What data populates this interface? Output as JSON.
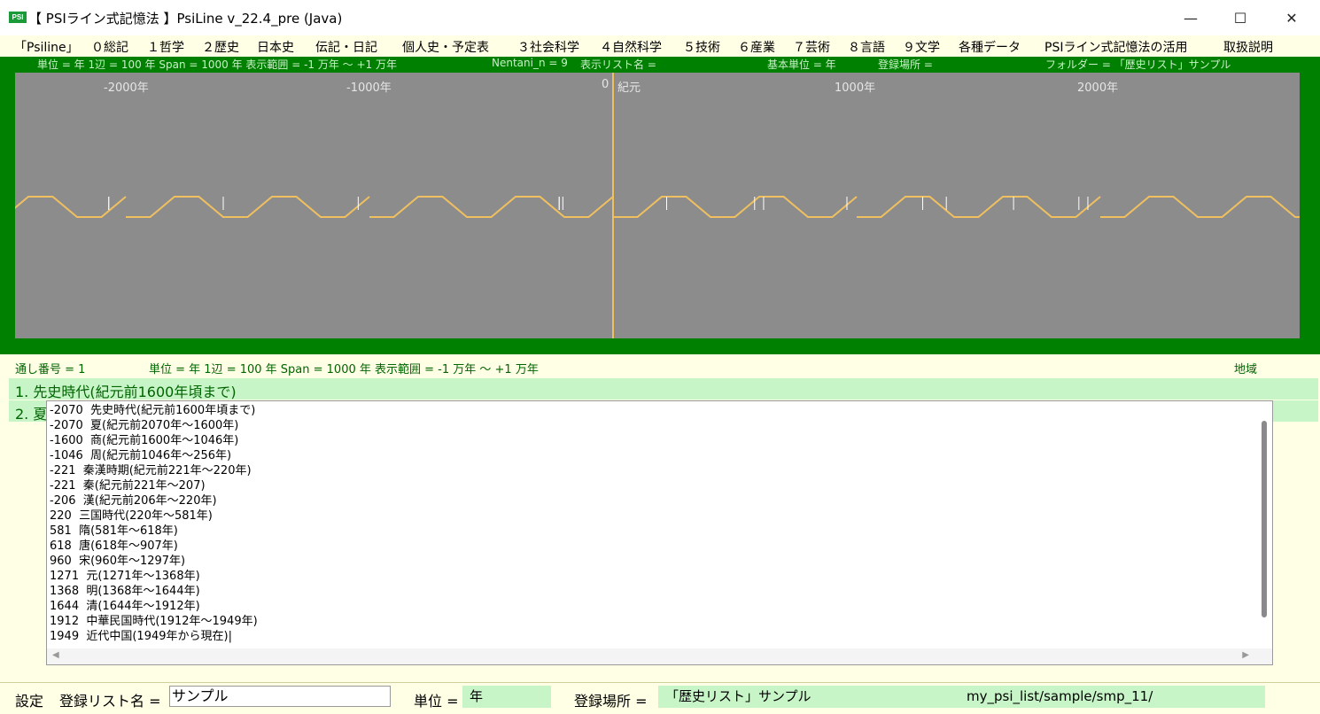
{
  "window": {
    "app_icon_text": "PSI",
    "title": "【 PSIライン式記憶法 】PsiLine v_22.4_pre (Java)",
    "minimize": "—",
    "maximize": "☐",
    "close": "✕"
  },
  "menu": [
    "「Psiline」",
    "０総記",
    "１哲学",
    "２歴史",
    "日本史",
    "伝記・日記",
    "個人史・予定表",
    "３社会科学",
    "４自然科学",
    "５技術",
    "６産業",
    "７芸術",
    "８言語",
    "９文学",
    "各種データ",
    "PSIライン式記憶法の活用",
    "取扱説明"
  ],
  "info_top": {
    "unit": "単位 = 年  1辺 = 100 年  Span = 1000 年  表示範囲 = -1 万年 〜 +1 万年",
    "nentani": "Nentani_n = 9",
    "list_name": "表示リスト名 =",
    "base_unit": "基本単位 = 年",
    "reg_place": "登録場所 =",
    "folder": "フォルダー = 「歴史リスト」サンプル"
  },
  "axis_labels": [
    "-2000年",
    "-1000年",
    "0",
    "紀元",
    "1000年",
    "2000年"
  ],
  "plot_colors": {
    "line": "#f0c060",
    "bg": "#8c8c8c",
    "frame": "#008000",
    "tick": "#ffffff"
  },
  "info_line": {
    "serial": "通し番号 = 1",
    "unit": "単位 = 年  1辺 = 100 年  Span = 1000 年  表示範囲 = -1 万年 〜 +1 万年",
    "region": "地域"
  },
  "rows": [
    "1. 先史時代(紀元前1600年頃まで)",
    "2. 夏"
  ],
  "list": [
    "-2070  先史時代(紀元前1600年頃まで)",
    "-2070  夏(紀元前2070年〜1600年)",
    "-1600  商(紀元前1600年〜1046年)",
    "-1046  周(紀元前1046年〜256年)",
    "-221  秦漢時期(紀元前221年〜220年)",
    "-221  秦(紀元前221年〜207)",
    "-206  漢(紀元前206年〜220年)",
    "220  三国時代(220年〜581年)",
    "581  隋(581年〜618年)",
    "618  唐(618年〜907年)",
    "960  宋(960年〜1297年)",
    "1271  元(1271年〜1368年)",
    "1368  明(1368年〜1644年)",
    "1644  清(1644年〜1912年)",
    "1912  中華民国時代(1912年〜1949年)",
    "1949  近代中国(1949年から現在)|"
  ],
  "status": {
    "settings": "設定",
    "list_name_label": "登録リスト名 =",
    "list_name_value": "サンプル",
    "unit_label": "単位 =",
    "unit_value": "年",
    "place_label": "登録場所 =",
    "place_value": "「歴史リスト」サンプル",
    "path_value": "my_psi_list/sample/smp_11/"
  }
}
